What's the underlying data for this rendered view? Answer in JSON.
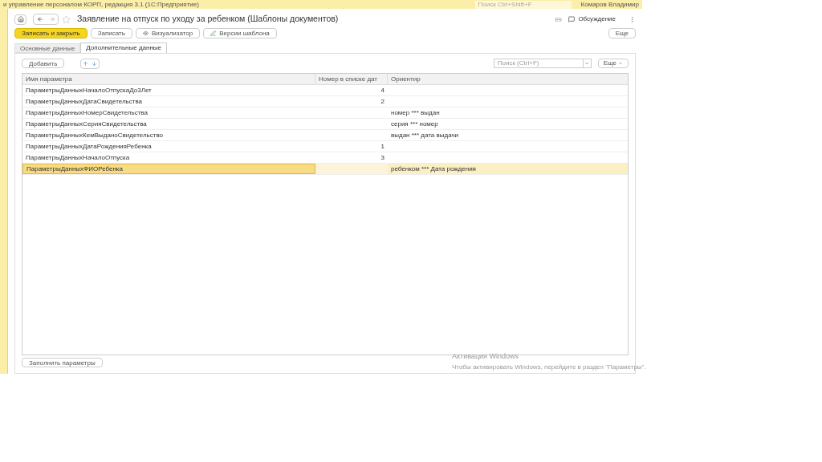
{
  "app_bar": {
    "title": "и управление персоналом КОРП, редакция 3.1 (1С:Предприятие)",
    "search": {
      "placeholder": "Поиск Ctrl+Shift+F"
    },
    "user": "Комаров Владимир"
  },
  "form": {
    "title": "Заявление на отпуск по уходу за ребенком (Шаблоны документов)",
    "favorite": false,
    "discussion": "Обсуждение"
  },
  "toolbar": [
    {
      "label": "Записать и закрыть",
      "kind": "primary"
    },
    {
      "label": "Записать",
      "kind": "plain"
    },
    {
      "label": "Визуализатор",
      "kind": "eye"
    },
    {
      "label": "Версии шаблона",
      "kind": "pen"
    }
  ],
  "more": "Еще",
  "tabs": [
    {
      "label": "Основные данные",
      "selected": false
    },
    {
      "label": "Дополнительные данные",
      "selected": true
    }
  ],
  "table_toolbar": {
    "add": "Добавить",
    "search": {
      "placeholder": "Поиск (Ctrl+F)"
    },
    "more": "Еще"
  },
  "table": {
    "columns": [
      "Имя параметра",
      "Номер в списке дат",
      "Ориентир"
    ],
    "rows": [
      {
        "cells": [
          "ПараметрыДанныхНачалоОтпускаДо3Лет",
          "4",
          ""
        ],
        "selected": false
      },
      {
        "cells": [
          "ПараметрыДанныхДатаСвидетельства",
          "2",
          ""
        ],
        "selected": false
      },
      {
        "cells": [
          "ПараметрыДанныхНомерСвидетельства",
          "",
          "номер *** выдан"
        ],
        "selected": false
      },
      {
        "cells": [
          "ПараметрыДанныхСерияСвидетельства",
          "",
          "серия *** номер"
        ],
        "selected": false
      },
      {
        "cells": [
          "ПараметрыДанныхКемВыданоСвидетельство",
          "",
          "выдан *** дата выдачи"
        ],
        "selected": false
      },
      {
        "cells": [
          "ПараметрыДанныхДатаРожденияРебенка",
          "1",
          ""
        ],
        "selected": false
      },
      {
        "cells": [
          "ПараметрыДанныхНачалоОтпуска",
          "3",
          ""
        ],
        "selected": false
      },
      {
        "cells": [
          "ПараметрыДанныхФИОРебенка",
          "",
          "ребенком *** Дата рождения"
        ],
        "selected": true
      }
    ]
  },
  "fill_button": "Заполнить параметры",
  "activation": {
    "title": "Активация Windows",
    "text": "Чтобы активировать Windows, перейдите в раздел \"Параметры\"."
  }
}
